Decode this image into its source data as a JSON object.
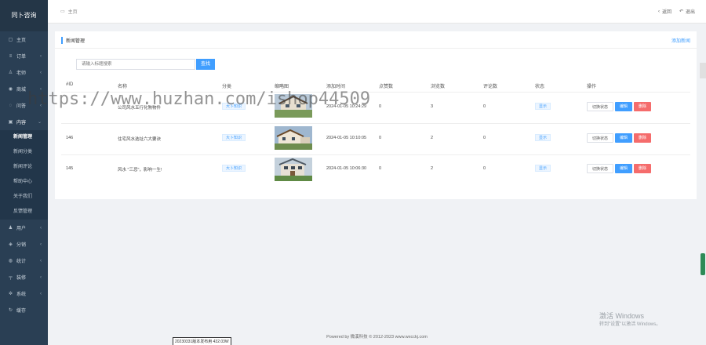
{
  "sidebar": {
    "logo": "同卜咨询",
    "items": [
      {
        "label": "主页",
        "icon": "home-icon",
        "glyph": "▢",
        "chevron": false
      },
      {
        "label": "订单",
        "icon": "list-icon",
        "glyph": "≡",
        "chevron": true
      },
      {
        "label": "老师",
        "icon": "user-icon",
        "glyph": "♙",
        "chevron": true
      },
      {
        "label": "商城",
        "icon": "shop-icon",
        "glyph": "◉",
        "chevron": true
      },
      {
        "label": "问答",
        "icon": "chat-icon",
        "glyph": "◌",
        "chevron": true
      },
      {
        "label": "内容",
        "icon": "content-icon",
        "glyph": "▣",
        "chevron": true
      }
    ],
    "sub_items": [
      "新闻管理",
      "新闻分类",
      "新闻评论",
      "帮助中心",
      "关于我们",
      "反馈管理"
    ],
    "items_after": [
      {
        "label": "用户",
        "icon": "user-group-icon",
        "glyph": "♟",
        "chevron": true
      },
      {
        "label": "分销",
        "icon": "share-icon",
        "glyph": "◈",
        "chevron": true
      },
      {
        "label": "统计",
        "icon": "chart-icon",
        "glyph": "◍",
        "chevron": true
      },
      {
        "label": "装修",
        "icon": "brush-icon",
        "glyph": "╤",
        "chevron": true
      },
      {
        "label": "系统",
        "icon": "gear-icon",
        "glyph": "✲",
        "chevron": true
      },
      {
        "label": "缓存",
        "icon": "refresh-icon",
        "glyph": "↻",
        "chevron": false
      }
    ]
  },
  "topbar": {
    "breadcrumb": "主页",
    "back_label": "返回",
    "logout_label": "退出"
  },
  "card": {
    "title": "新闻管理",
    "add_label": "添加新闻"
  },
  "search": {
    "placeholder": "请输入标题搜索",
    "button_label": "查找"
  },
  "table": {
    "headers": [
      "#ID",
      "名称",
      "分类",
      "缩略图",
      "添加时间",
      "点赞数",
      "浏览数",
      "评论数",
      "状态",
      "操作"
    ],
    "rows": [
      {
        "id": "",
        "name": "公司风水五行化煞物件",
        "category": "大卜知识",
        "time": "2024-01-05 10:24:29",
        "likes": "0",
        "views": "3",
        "comments": "0",
        "status": "显示"
      },
      {
        "id": "146",
        "name": "住宅风水选址六大要诀",
        "category": "大卜知识",
        "time": "2024-01-05 10:10:05",
        "likes": "0",
        "views": "2",
        "comments": "0",
        "status": "显示"
      },
      {
        "id": "145",
        "name": "风水 \"三忌\"，影响一生!",
        "category": "大卜知识",
        "time": "2024-01-05 10:06:30",
        "likes": "0",
        "views": "2",
        "comments": "0",
        "status": "显示"
      }
    ],
    "actions": {
      "toggle": "切换状态",
      "edit": "编辑",
      "delete": "删除"
    }
  },
  "footer": {
    "text": "Powered by 微溪科技 © 2012-2023 www.wxcckj.com",
    "tag": "20230331版本发布用 432.03W"
  },
  "overlay": {
    "watermark": "https://www.huzhan.com/ishop44509",
    "windows_title": "激活 Windows",
    "windows_sub": "转到\"设置\"以激活 Windows。"
  },
  "colors": {
    "sidebar": "#2a3f54",
    "accent": "#409eff",
    "danger": "#f56c6c"
  }
}
